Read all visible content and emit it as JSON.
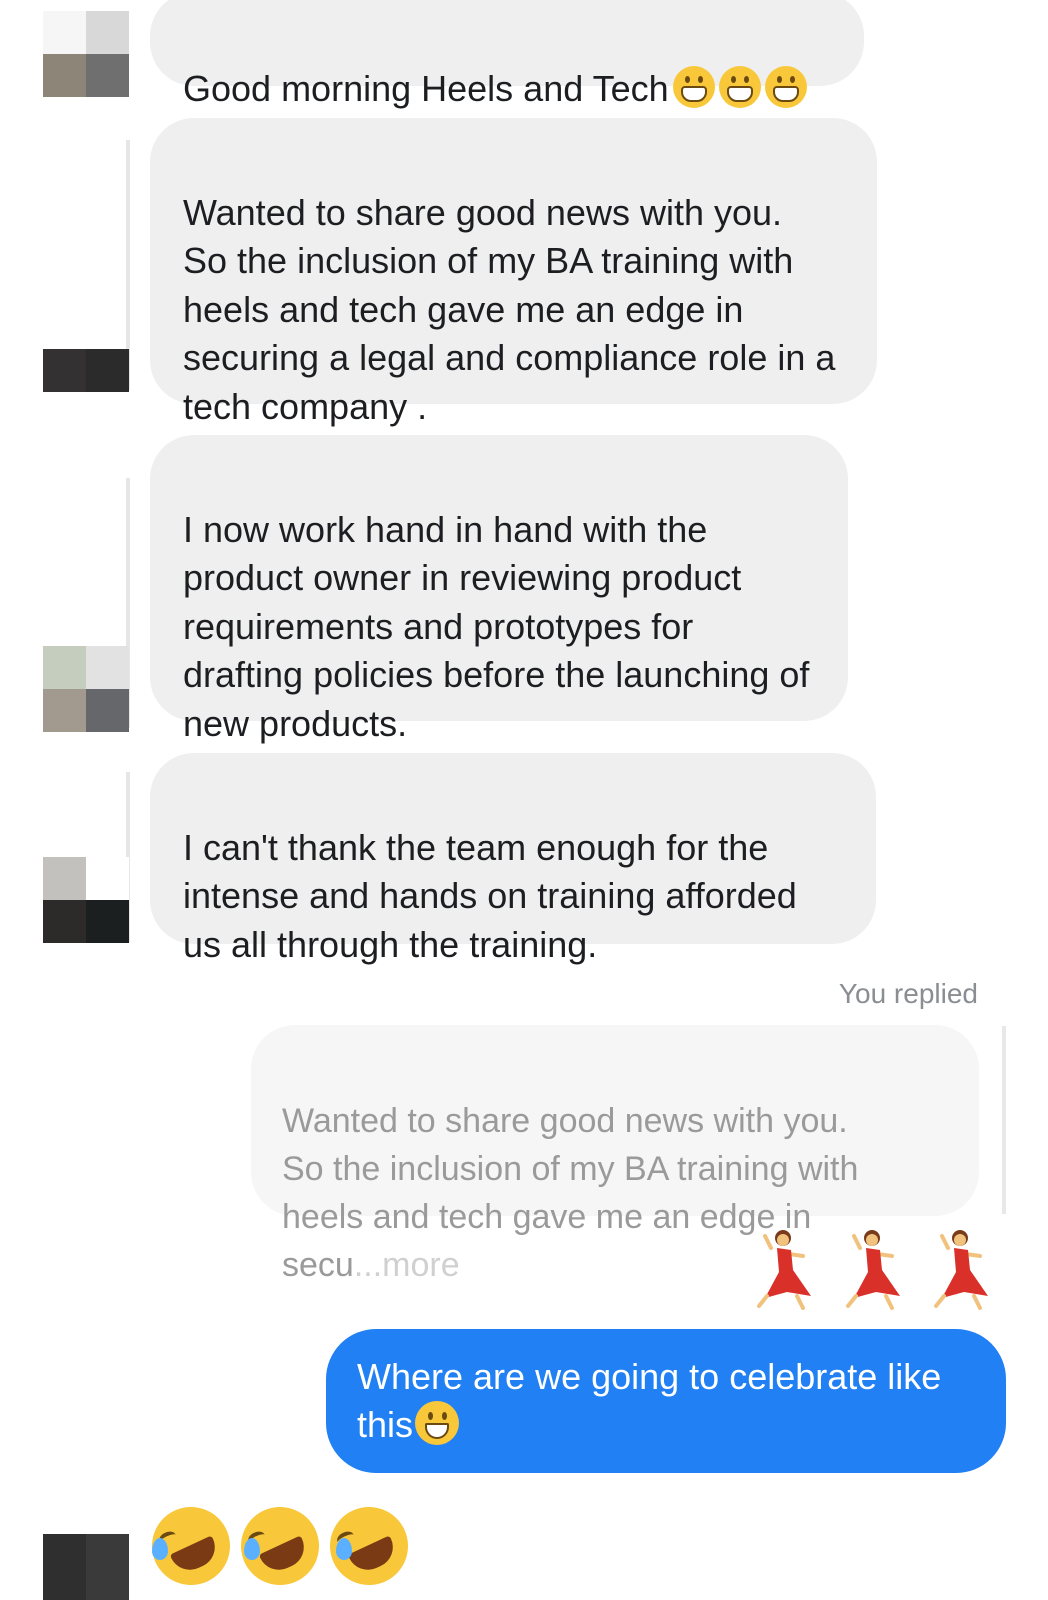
{
  "messages": [
    {
      "text": "Good morning Heels and Tech"
    },
    {
      "text": "Wanted to share good news with you.\nSo the inclusion of my BA training with heels and tech gave me an edge in securing a legal and compliance role in a tech company ."
    },
    {
      "text": "I now work hand in hand with the product owner in reviewing product requirements and prototypes for drafting policies before the launching of new products."
    },
    {
      "text": "I can't thank the team enough for the intense and hands on training afforded us all through the training."
    }
  ],
  "reply": {
    "label": "You replied",
    "quote": "Wanted to share good news with you.\nSo the inclusion of my BA training with heels and tech gave me an edge in secu",
    "more": "...more"
  },
  "sent_message": {
    "text": "Where are we going to celebrate like this"
  },
  "icons": {
    "grin": "grinning-face-with-smiling-eyes-icon",
    "dancer": "woman-dancing-icon",
    "smile": "grinning-face-icon",
    "rofl": "rolling-on-the-floor-laughing-icon"
  },
  "colors": {
    "received_bubble": "#efefef",
    "sent_bubble": "#2180f3",
    "quote_text": "#9a9a9a"
  }
}
